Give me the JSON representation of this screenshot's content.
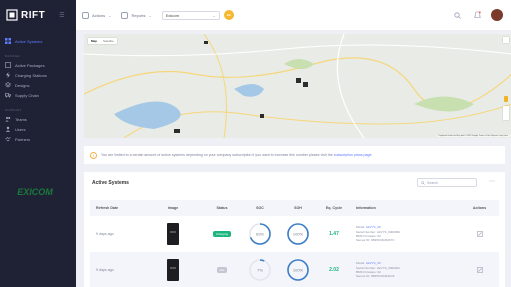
{
  "brand": {
    "name": "RIFT"
  },
  "sidebar": {
    "items": [
      {
        "label": "Active Systems",
        "icon": "dashboard-icon",
        "active": true
      }
    ],
    "section1": "MANAGE",
    "items_manage": [
      {
        "label": "Active Packages",
        "icon": "box-icon"
      },
      {
        "label": "Charging Stations",
        "icon": "bolt-icon"
      },
      {
        "label": "Designs",
        "icon": "layers-icon"
      },
      {
        "label": "Supply Chain",
        "icon": "truck-icon"
      }
    ],
    "section2": "SUPPORT",
    "items_support": [
      {
        "label": "Teams",
        "icon": "users-icon"
      },
      {
        "label": "Users",
        "icon": "user-icon"
      },
      {
        "label": "Partners",
        "icon": "handshake-icon"
      }
    ],
    "logo_text": "EXICOM"
  },
  "topbar": {
    "actions_label": "Actions",
    "reports_label": "Reports",
    "org_select": "Exicom",
    "badge": "EX"
  },
  "map": {
    "type_map": "Map",
    "type_satellite": "Satellite",
    "attribution": "Keyboard shortcuts  Map data ©2023 Google  Terms of Use  Report a map error"
  },
  "notice": {
    "text": "You are limited to a certain amount of active systems depending on your company subscription if you want to increase this number please visit the",
    "link": "subscription plans page."
  },
  "table": {
    "title": "Active Systems",
    "search_placeholder": "Search",
    "headers": [
      "Refresh Date",
      "Image",
      "Status",
      "SOC",
      "SOH",
      "Eq. Cycle",
      "Information",
      "Actions"
    ],
    "rows": [
      {
        "refresh": "9 days ago",
        "status": "Charging",
        "status_color": "#1bb57e",
        "soc": "69%",
        "soc_value": 0.69,
        "soh": "100%",
        "soh_value": 1.0,
        "cycle": "1.47",
        "model": "LEVYS_40",
        "serial": "LEVYS_0000099",
        "bms": "BMS Firmware: 02",
        "sensor": "Sensor ID: 0B35C0D46267C"
      },
      {
        "refresh": "9 days ago",
        "status": "Idle",
        "status_color": "#c4c7d3",
        "soc": "7%",
        "soc_value": 0.07,
        "soh": "100%",
        "soh_value": 1.0,
        "cycle": "2.02",
        "model": "LEVYS_40",
        "serial": "LEVYS_0000022",
        "bms": "BMS Firmware: 02",
        "sensor": "Sensor ID: 0B35C0D463A32"
      }
    ]
  },
  "colors": {
    "accent": "#5f7cff",
    "sidebar_bg": "#1f2235",
    "ring": "#3d7fc6",
    "success": "#1bb57e"
  }
}
